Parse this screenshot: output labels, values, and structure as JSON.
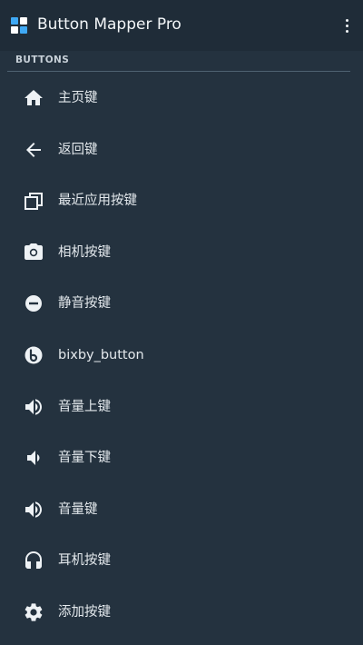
{
  "header": {
    "title": "Button Mapper Pro",
    "overflow_icon": "more-vert-icon"
  },
  "section": {
    "title": "BUTTONS"
  },
  "buttons": [
    {
      "label": "主页键",
      "icon": "home-icon"
    },
    {
      "label": "返回键",
      "icon": "back-arrow-icon"
    },
    {
      "label": "最近应用按键",
      "icon": "recent-apps-icon"
    },
    {
      "label": "相机按键",
      "icon": "camera-icon"
    },
    {
      "label": "静音按键",
      "icon": "mute-icon"
    },
    {
      "label": "bixby_button",
      "icon": "bixby-icon"
    },
    {
      "label": "音量上键",
      "icon": "volume-up-icon"
    },
    {
      "label": "音量下键",
      "icon": "volume-down-icon"
    },
    {
      "label": "音量键",
      "icon": "volume-icon"
    },
    {
      "label": "耳机按键",
      "icon": "headset-icon"
    },
    {
      "label": "添加按键",
      "icon": "settings-gear-icon"
    }
  ],
  "colors": {
    "background": "#24323f",
    "appbar": "#1f2c38",
    "text": "#e4e9ed",
    "accent": "#3fa9f5"
  }
}
